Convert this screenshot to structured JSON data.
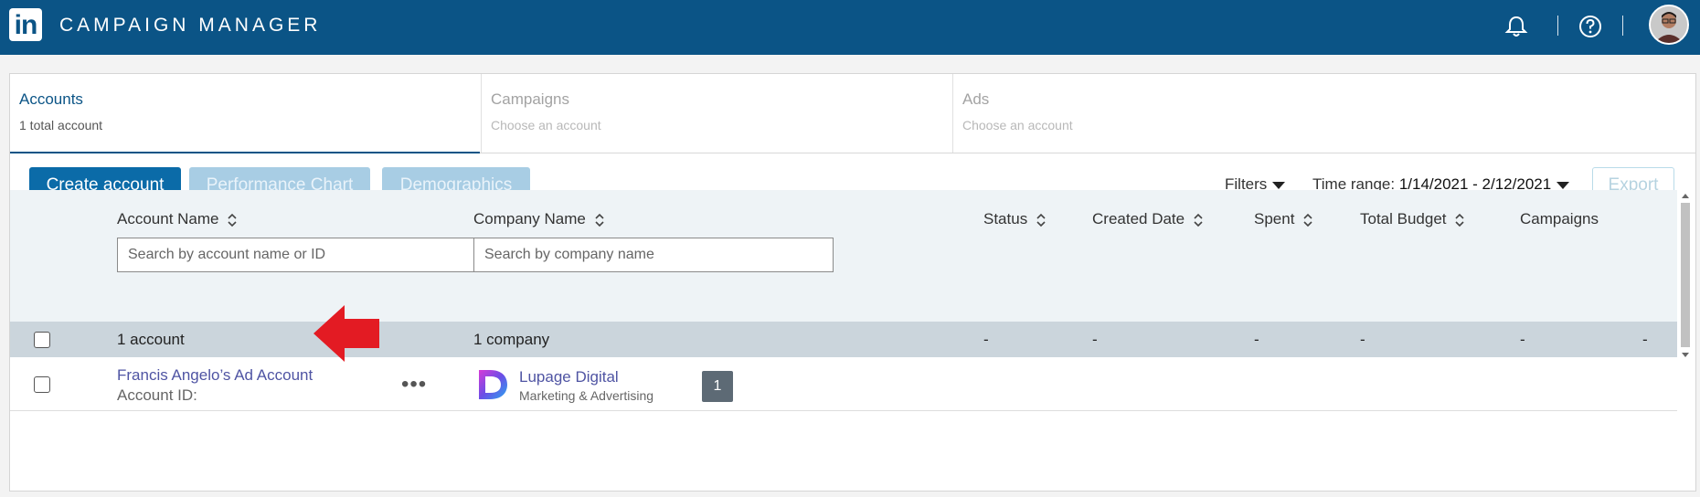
{
  "app": {
    "logo_text": "in",
    "title": "CAMPAIGN MANAGER"
  },
  "header": {
    "icons": [
      "bell-icon",
      "help-icon",
      "avatar"
    ]
  },
  "tabs": [
    {
      "title": "Accounts",
      "subtitle": "1 total account",
      "active": true
    },
    {
      "title": "Campaigns",
      "subtitle": "Choose an account",
      "active": false
    },
    {
      "title": "Ads",
      "subtitle": "Choose an account",
      "active": false
    }
  ],
  "toolbar": {
    "create_label": "Create account",
    "performance_label": "Performance Chart",
    "demographics_label": "Demographics",
    "filters_label": "Filters",
    "time_range_label": "Time range:",
    "time_range_value": "1/14/2021 - 2/12/2021",
    "export_label": "Export"
  },
  "table": {
    "columns": [
      "Account Name",
      "Company Name",
      "Status",
      "Created Date",
      "Spent",
      "Total Budget",
      "Campaigns"
    ],
    "search_account_placeholder": "Search by account name or ID",
    "search_company_placeholder": "Search by company name",
    "summary": {
      "account": "1 account",
      "company": "1 company",
      "status": "-",
      "created": "-",
      "spent": "-",
      "budget": "-",
      "campaigns": "-",
      "last": "-"
    },
    "rows": [
      {
        "account_name": "Francis Angelo’s Ad Account",
        "account_id_label": "Account ID:",
        "more": "•••",
        "company_name": "Lupage Digital",
        "company_sub": "Marketing & Advertising"
      }
    ]
  },
  "pagination": {
    "current": "1"
  },
  "colors": {
    "brand": "#0b5486",
    "link": "#4f54a3",
    "arrow": "#e31b23"
  }
}
